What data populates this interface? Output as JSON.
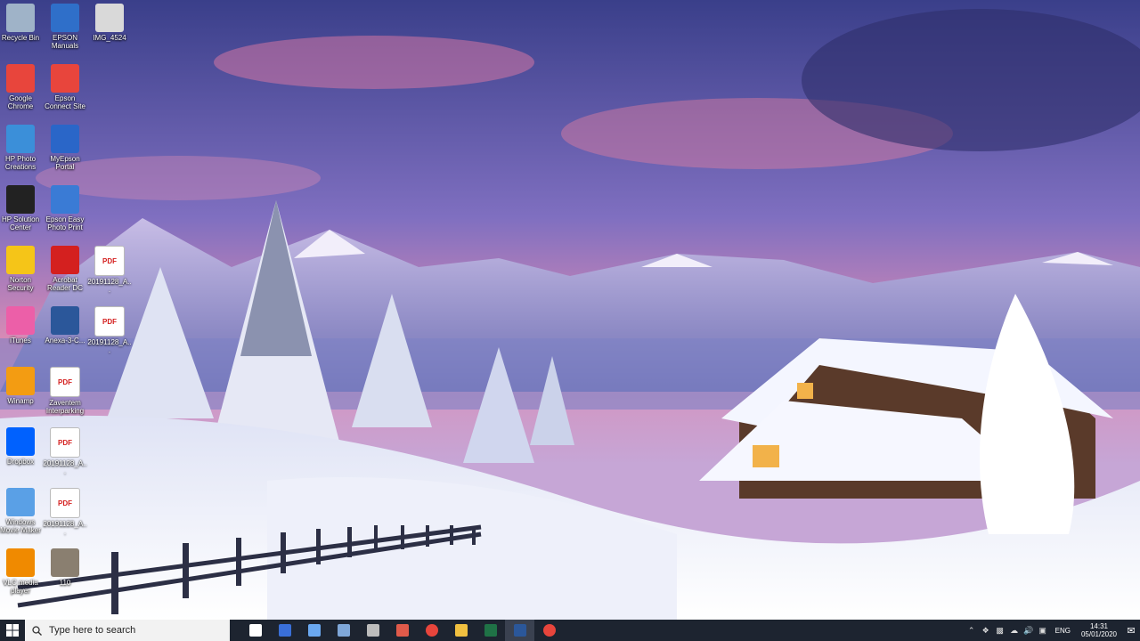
{
  "desktop": {
    "icons": [
      {
        "label": "Recycle Bin",
        "icon": "recycle-bin-icon",
        "color": "#9fb3c8"
      },
      {
        "label": "EPSON Manuals",
        "icon": "epson-manuals-icon",
        "color": "#2f6fc9"
      },
      {
        "label": "IMG_4524",
        "icon": "image-file-icon",
        "color": "#d9d9d9"
      },
      {
        "label": "Google Chrome",
        "icon": "chrome-icon",
        "color": "#e8453c"
      },
      {
        "label": "Epson Connect Site",
        "icon": "chrome-icon",
        "color": "#e8453c"
      },
      {
        "label": "HP Photo Creations",
        "icon": "hp-photo-icon",
        "color": "#3b8fd9"
      },
      {
        "label": "MyEpson Portal",
        "icon": "myepson-icon",
        "color": "#2a66c8"
      },
      {
        "label": "HP Solution Center",
        "icon": "hp-icon",
        "color": "#222222"
      },
      {
        "label": "Epson Easy Photo Print",
        "icon": "epson-photo-icon",
        "color": "#3a7bd5"
      },
      {
        "label": "Norton Security",
        "icon": "norton-icon",
        "color": "#f5c518"
      },
      {
        "label": "Acrobat Reader DC",
        "icon": "acrobat-icon",
        "color": "#d4201f"
      },
      {
        "label": "20191128_A...",
        "icon": "pdf-icon",
        "color": "#ffffff"
      },
      {
        "label": "iTunes",
        "icon": "itunes-icon",
        "color": "#ec5fa8"
      },
      {
        "label": "Anexa-3-C...",
        "icon": "word-doc-icon",
        "color": "#2b579a"
      },
      {
        "label": "20191128_A...",
        "icon": "pdf-icon",
        "color": "#ffffff"
      },
      {
        "label": "Winamp",
        "icon": "winamp-icon",
        "color": "#f39c12"
      },
      {
        "label": "Zaventem Interparking",
        "icon": "pdf-icon",
        "color": "#ffffff"
      },
      {
        "label": "Dropbox",
        "icon": "dropbox-icon",
        "color": "#0061fe"
      },
      {
        "label": "20191128_A...",
        "icon": "pdf-icon",
        "color": "#ffffff"
      },
      {
        "label": "Windows Movie Maker",
        "icon": "movie-maker-icon",
        "color": "#5aa0e6"
      },
      {
        "label": "20191128_A...",
        "icon": "pdf-icon",
        "color": "#ffffff"
      },
      {
        "label": "VLC media player",
        "icon": "vlc-icon",
        "color": "#f08a00"
      },
      {
        "label": "110",
        "icon": "image-thumbnail-icon",
        "color": "#8a7f70"
      }
    ]
  },
  "taskbar": {
    "search_placeholder": "Type here to search",
    "apps": [
      {
        "name": "cortana",
        "color": "#ffffff"
      },
      {
        "name": "app-blue",
        "color": "#3a6fd8"
      },
      {
        "name": "file-explorer-blue",
        "color": "#6aa8f0"
      },
      {
        "name": "network-app",
        "color": "#7fa7d8"
      },
      {
        "name": "notepad-app",
        "color": "#bcbcbc"
      },
      {
        "name": "media-app",
        "color": "#e05a4a"
      },
      {
        "name": "chrome",
        "color": "#e8453c"
      },
      {
        "name": "file-explorer",
        "color": "#f0c040"
      },
      {
        "name": "excel",
        "color": "#1f7246"
      },
      {
        "name": "word",
        "color": "#2b579a"
      },
      {
        "name": "chrome-2",
        "color": "#e8453c"
      }
    ],
    "active_app_index": 9,
    "tray": {
      "language": "ENG",
      "time": "14:31",
      "date": "05/01/2020"
    }
  }
}
